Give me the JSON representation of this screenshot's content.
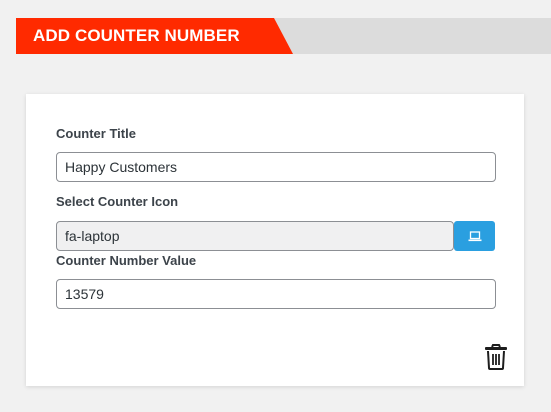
{
  "header": {
    "title": "ADD COUNTER NUMBER"
  },
  "form": {
    "counter_title": {
      "label": "Counter Title",
      "value": "Happy Customers"
    },
    "counter_icon": {
      "label": "Select Counter Icon",
      "value": "fa-laptop",
      "button_icon": "laptop-icon"
    },
    "counter_value": {
      "label": "Counter Number Value",
      "value": "13579"
    },
    "delete_icon": "trash-icon"
  },
  "colors": {
    "header_accent": "#ff2a00",
    "header_bar": "#dcdcdc",
    "icon_button": "#2a9fe0",
    "arrow": "#e8211b"
  }
}
